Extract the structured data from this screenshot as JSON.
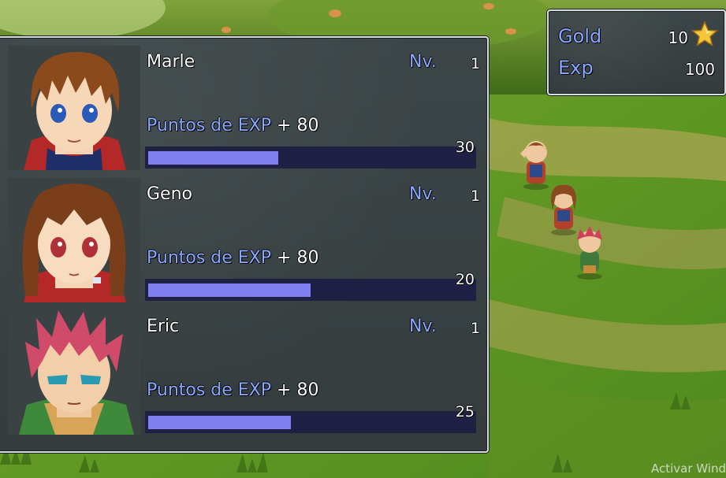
{
  "gold_window": {
    "gold_label": "Gold",
    "gold_value": "10",
    "exp_label": "Exp",
    "exp_value": "100",
    "icon": "star-icon"
  },
  "party": [
    {
      "name": "Marle",
      "level_label": "Nv.",
      "level": "1",
      "exp_label": "Puntos de EXP",
      "exp_gain": "+ 80",
      "bar_value": "30",
      "bar_fraction": 0.4
    },
    {
      "name": "Geno",
      "level_label": "Nv.",
      "level": "1",
      "exp_label": "Puntos de EXP",
      "exp_gain": "+ 80",
      "bar_value": "20",
      "bar_fraction": 0.5
    },
    {
      "name": "Eric",
      "level_label": "Nv.",
      "level": "1",
      "exp_label": "Puntos de EXP",
      "exp_gain": "+ 80",
      "bar_value": "25",
      "bar_fraction": 0.44
    }
  ],
  "watermark": "Activar Wind",
  "colors": {
    "label_blue": "#8aa8ff",
    "bar_fill": "#8080f2",
    "bar_track": "#1f2044",
    "window_bg": "#3a4244",
    "grass": "#5a8a1f"
  }
}
